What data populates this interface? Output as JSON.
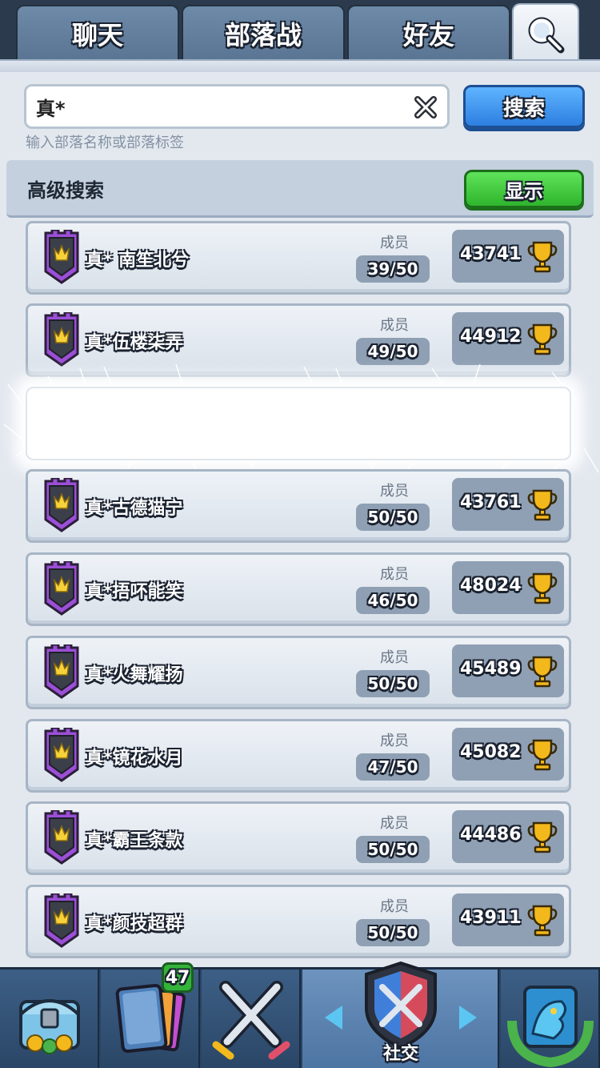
{
  "tabs": [
    {
      "label": "聊天"
    },
    {
      "label": "部落战"
    },
    {
      "label": "好友"
    }
  ],
  "search": {
    "value": "真*",
    "hint": "输入部落名称或部落标签",
    "button_label": "搜索"
  },
  "advanced": {
    "label": "高级搜索",
    "button_label": "显示"
  },
  "members_label": "成员",
  "clans": [
    {
      "name": "真* 南笙北兮",
      "members": "39/50",
      "trophies": "43741"
    },
    {
      "name": "真*伍楼柒弄",
      "members": "49/50",
      "trophies": "44912"
    },
    {
      "name": "真*古德猫宁",
      "members": "50/50",
      "trophies": "43761"
    },
    {
      "name": "真*捂吥能笑",
      "members": "46/50",
      "trophies": "48024"
    },
    {
      "name": "真*火舞耀扬",
      "members": "50/50",
      "trophies": "45489"
    },
    {
      "name": "真*镜花水月",
      "members": "47/50",
      "trophies": "45082"
    },
    {
      "name": "真*霸王条款",
      "members": "50/50",
      "trophies": "44486"
    },
    {
      "name": "真*颜技超群",
      "members": "50/50",
      "trophies": "43911"
    }
  ],
  "bottom_nav": {
    "cards_badge": "47",
    "active_label": "社交"
  },
  "icons": {
    "search_tab": "magnifier-icon",
    "clear": "clear-x-icon",
    "clan_badge": "clan-shield-badge-icon",
    "trophy": "trophy-icon",
    "shop": "chest-icon",
    "cards": "cards-icon",
    "battle": "crossed-swords-icon",
    "social": "social-shield-icon",
    "events": "dragon-emblem-icon"
  },
  "colors": {
    "search_button": "#2d7fe0",
    "show_button": "#2fb52d",
    "badge_purple": "#9b4fd6",
    "trophy_gold": "#f3b81c"
  }
}
